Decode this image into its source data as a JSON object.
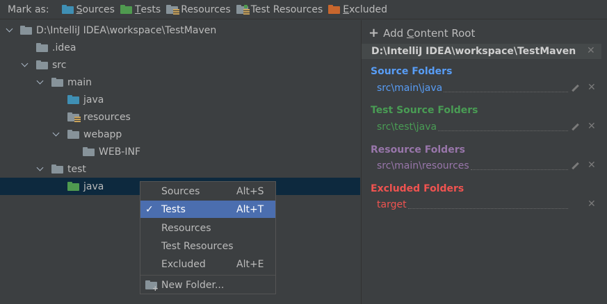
{
  "toolbar": {
    "label": "Mark as:",
    "buttons": [
      {
        "key": "S",
        "rest": "ources",
        "icon": "sources-folder-icon"
      },
      {
        "key": "T",
        "rest": "ests",
        "icon": "tests-folder-icon"
      },
      {
        "key": "",
        "rest": "Resources",
        "icon": "resources-folder-icon"
      },
      {
        "key": "",
        "rest": "Test Resources",
        "icon": "test-resources-folder-icon"
      },
      {
        "key": "E",
        "rest": "xcluded",
        "icon": "excluded-folder-icon"
      }
    ]
  },
  "tree": {
    "items": [
      {
        "label": "D:\\IntelliJ IDEA\\workspace\\TestMaven",
        "icon": "folder-icon"
      },
      {
        "label": ".idea",
        "icon": "folder-icon"
      },
      {
        "label": "src",
        "icon": "folder-icon"
      },
      {
        "label": "main",
        "icon": "folder-icon"
      },
      {
        "label": "java",
        "icon": "sources-folder-icon"
      },
      {
        "label": "resources",
        "icon": "resources-folder-icon"
      },
      {
        "label": "webapp",
        "icon": "folder-icon"
      },
      {
        "label": "WEB-INF",
        "icon": "folder-icon"
      },
      {
        "label": "test",
        "icon": "folder-icon"
      },
      {
        "label": "java",
        "icon": "tests-folder-icon"
      }
    ]
  },
  "context_menu": {
    "items": [
      {
        "label": "Sources",
        "shortcut": "Alt+S"
      },
      {
        "label": "Tests",
        "shortcut": "Alt+T"
      },
      {
        "label": "Resources",
        "shortcut": ""
      },
      {
        "label": "Test Resources",
        "shortcut": ""
      },
      {
        "label": "Excluded",
        "shortcut": "Alt+E"
      }
    ],
    "new_folder": "New Folder..."
  },
  "right_panel": {
    "add_plus": "+",
    "add_prefix": "Add ",
    "add_key": "C",
    "add_rest": "ontent Root",
    "root_path": "D:\\IntelliJ IDEA\\workspace\\TestMaven",
    "close": "✕",
    "sections": [
      {
        "title": "Source Folders",
        "path": "src\\main\\java",
        "color": "#589df6"
      },
      {
        "title": "Test Source Folders",
        "path": "src\\test\\java",
        "color": "#499c54"
      },
      {
        "title": "Resource Folders",
        "path": "src\\main\\resources",
        "color": "#9876aa"
      },
      {
        "title": "Excluded Folders",
        "path": "target",
        "color": "#ef5350"
      }
    ]
  },
  "colors": {
    "background": "#3c3f41",
    "selection": "#0d293e",
    "menu_highlight": "#4b6eaf"
  }
}
